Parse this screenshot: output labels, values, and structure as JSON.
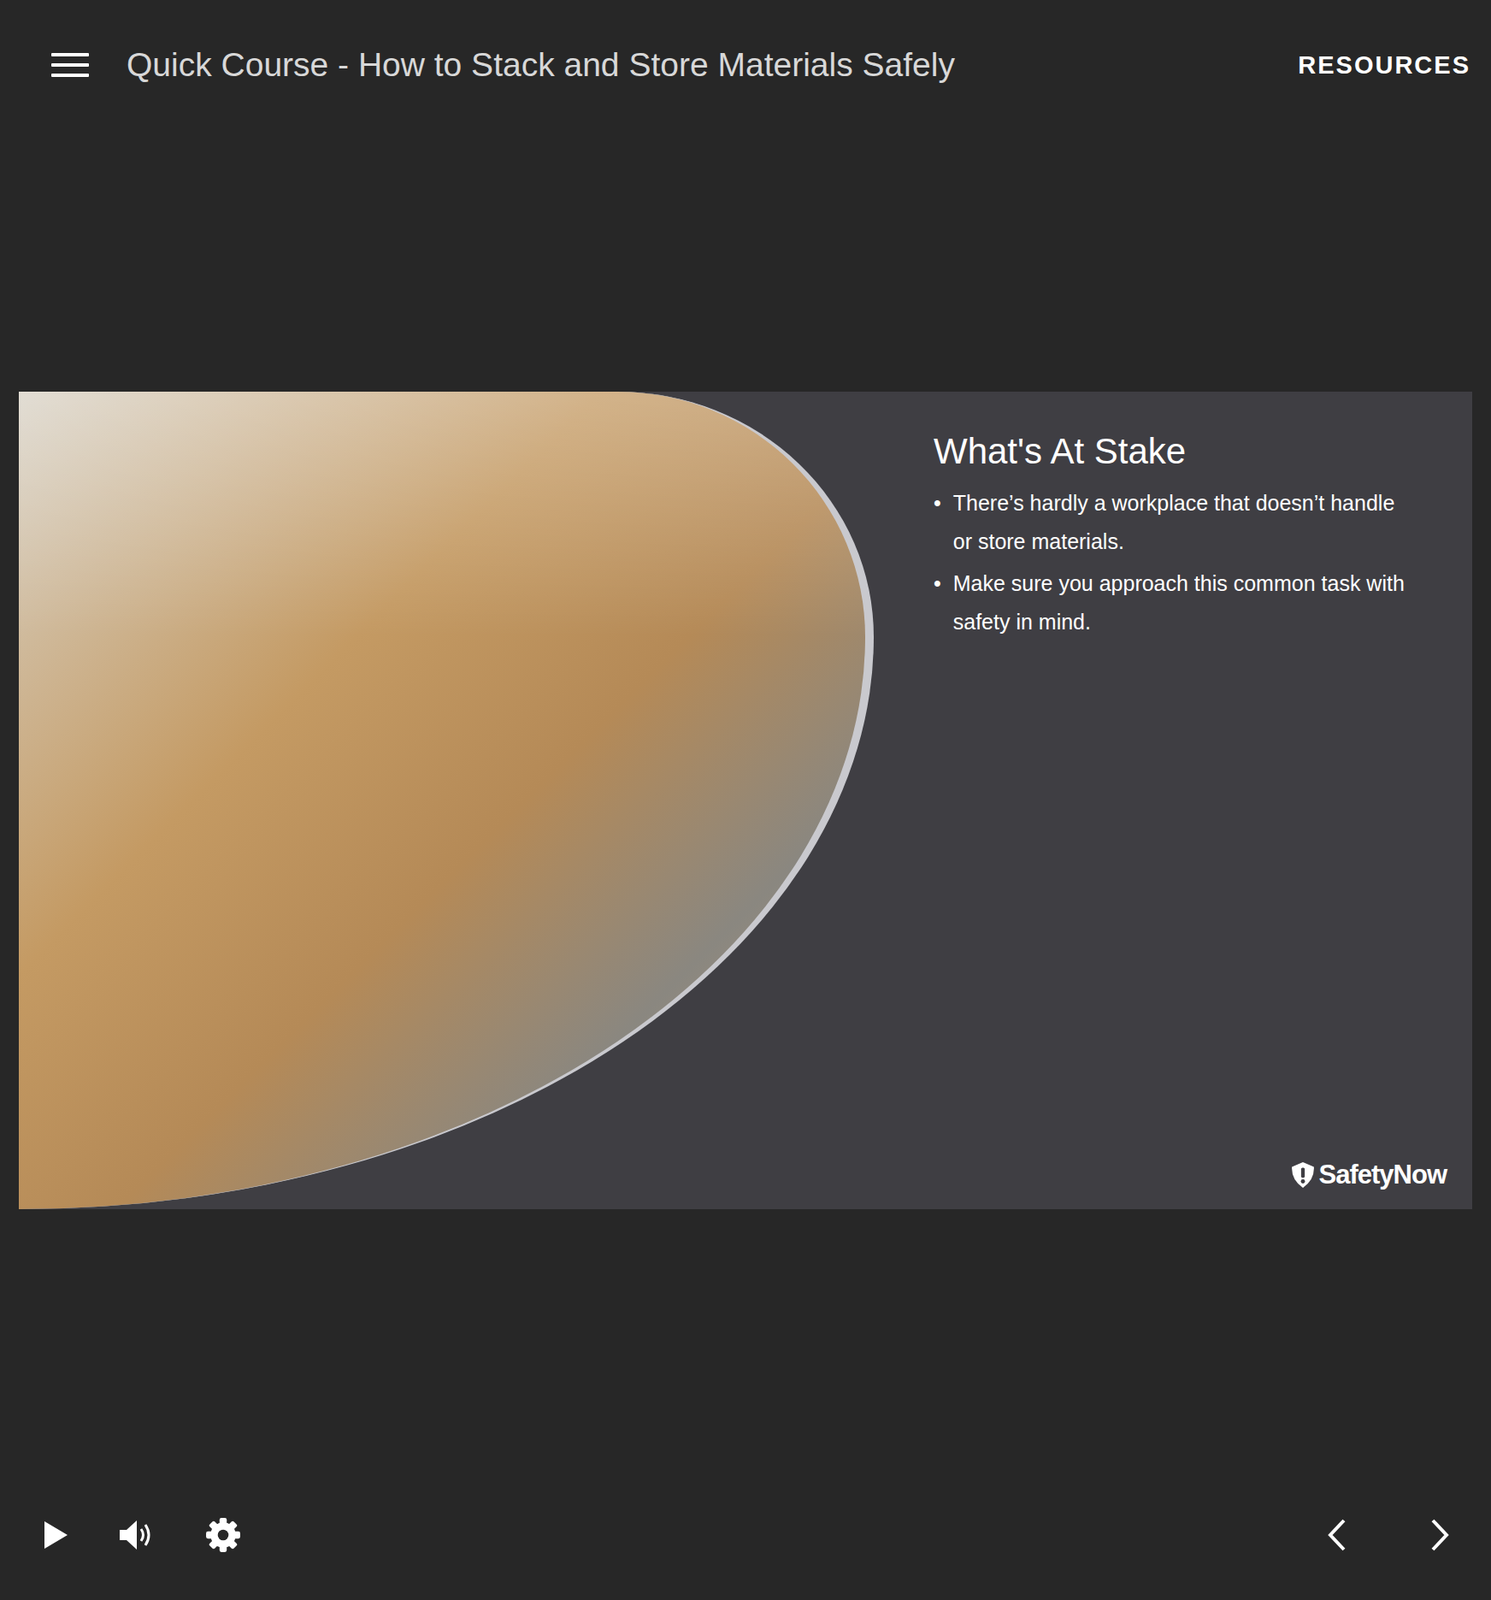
{
  "header": {
    "title": "Quick Course - How to Stack and Store Materials Safely",
    "resources": "RESOURCES"
  },
  "slide": {
    "heading": "What's At Stake",
    "bullets": [
      "There’s hardly a workplace that doesn’t handle or store materials.",
      "Make sure you approach this common task with safety in mind."
    ],
    "bullet_mark": "•",
    "logo": "SafetyNow"
  },
  "controls": {
    "playing": false
  }
}
